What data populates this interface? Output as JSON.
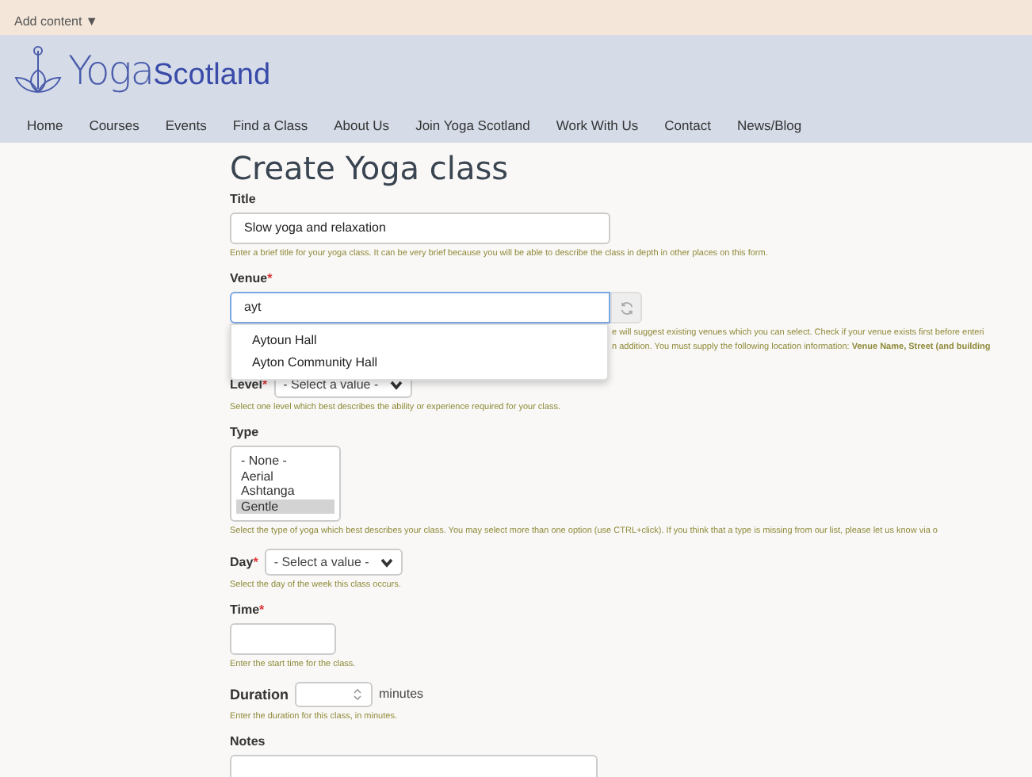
{
  "admin_bar": {
    "label": "Add content",
    "caret": "▼"
  },
  "header": {
    "logo_word_1": "Yoga",
    "logo_word_2": "Scotland"
  },
  "nav": [
    {
      "label": "Home"
    },
    {
      "label": "Courses"
    },
    {
      "label": "Events"
    },
    {
      "label": "Find a Class"
    },
    {
      "label": "About Us"
    },
    {
      "label": "Join Yoga Scotland"
    },
    {
      "label": "Work With Us"
    },
    {
      "label": "Contact"
    },
    {
      "label": "News/Blog"
    }
  ],
  "page_title": "Create Yoga class",
  "fields": [
    {
      "kind": "text",
      "label": "Title",
      "value": "Slow yoga and relaxation",
      "help": "Enter a brief title for your yoga class. It can be very brief because you will be able to describe the class in depth in other places on this form."
    },
    {
      "kind": "autocomplete",
      "label": "Venue",
      "required_mark": "*",
      "value": "ayt",
      "suggestions": [
        "Aytoun Hall",
        "Ayton Community Hall"
      ],
      "help_lines": [
        "e will suggest existing venues which you can select. Check if your venue exists first before enteri",
        "n addition. You must supply the following location information: **Venue Name, Street (and building**"
      ]
    },
    {
      "kind": "select",
      "label": "Level",
      "required_mark": "*",
      "value": "- Select a value -",
      "help": "Select one level which best describes the ability or experience required for your class."
    },
    {
      "kind": "listbox",
      "label": "Type",
      "options": [
        {
          "label": "- None -",
          "selected": false
        },
        {
          "label": "Aerial",
          "selected": false
        },
        {
          "label": "Ashtanga",
          "selected": false
        },
        {
          "label": "Gentle",
          "selected": true
        }
      ],
      "help": "Select the type of yoga which best describes your class. You may select more than one option (use CTRL+click). If you think that a type is missing from our list, please let us know via o"
    },
    {
      "kind": "select",
      "label": "Day",
      "required_mark": "*",
      "value": "- Select a value -",
      "help": "Select the day of the week this class occurs."
    },
    {
      "kind": "text",
      "label": "Time",
      "required_mark": "*",
      "help": "Enter the start time for the class."
    },
    {
      "kind": "number",
      "label": "Duration",
      "suffix": "minutes",
      "help": "Enter the duration for this class, in minutes."
    },
    {
      "kind": "textarea",
      "label": "Notes"
    }
  ]
}
